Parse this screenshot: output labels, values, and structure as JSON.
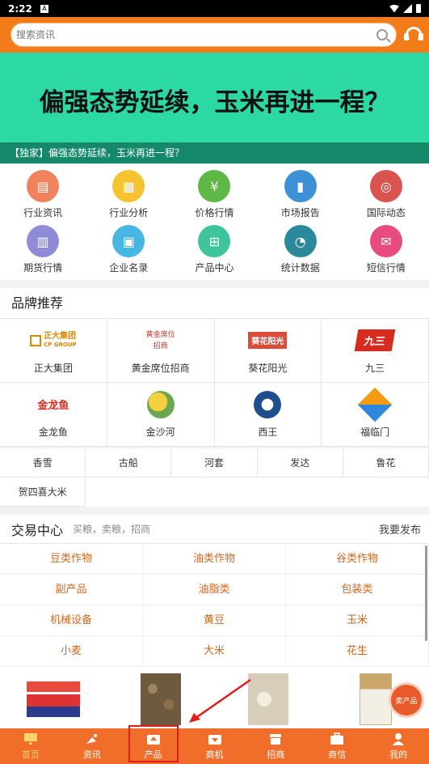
{
  "statusbar": {
    "time": "2:22",
    "app_icon": "A"
  },
  "search": {
    "placeholder": "搜索资讯"
  },
  "banner": {
    "headline": "偏强态势延续，玉米再进一程？",
    "caption": "【独家】偏强态势延续，玉米再进一程？"
  },
  "categories": [
    {
      "label": "行业资讯",
      "color": "#f0825d"
    },
    {
      "label": "行业分析",
      "color": "#f5c330"
    },
    {
      "label": "价格行情",
      "color": "#5db845"
    },
    {
      "label": "市场报告",
      "color": "#3d8fd6"
    },
    {
      "label": "国际动态",
      "color": "#d9534f"
    },
    {
      "label": "期货行情",
      "color": "#8f8bd6"
    },
    {
      "label": "企业名录",
      "color": "#47b6e0"
    },
    {
      "label": "产品中心",
      "color": "#3ec49c"
    },
    {
      "label": "统计数据",
      "color": "#2a8a9a"
    },
    {
      "label": "短信行情",
      "color": "#e64d7c"
    }
  ],
  "brands": {
    "title": "品牌推荐",
    "items": [
      {
        "label": "正大集团",
        "logo_text": "正大集团",
        "logo_sub": "CP GROUP"
      },
      {
        "label": "黄金席位招商",
        "logo_text": "黄金席位",
        "logo_sub": "招商"
      },
      {
        "label": "葵花阳光",
        "logo_text": "葵花阳光",
        "logo_sub": ""
      },
      {
        "label": "九三",
        "logo_text": "九三",
        "logo_sub": ""
      },
      {
        "label": "金龙鱼",
        "logo_text": "金龙鱼",
        "logo_sub": ""
      },
      {
        "label": "金沙河",
        "logo_text": "",
        "logo_sub": ""
      },
      {
        "label": "西王",
        "logo_text": "",
        "logo_sub": ""
      },
      {
        "label": "福临门",
        "logo_text": "",
        "logo_sub": ""
      }
    ]
  },
  "tags": [
    "香雪",
    "古船",
    "河套",
    "发达",
    "鲁花",
    "贺四喜大米"
  ],
  "trade": {
    "title": "交易中心",
    "subtitle": "买粮，卖粮，招商",
    "publish": "我要发布",
    "items": [
      "豆类作物",
      "油类作物",
      "谷类作物",
      "副产品",
      "油脂类",
      "包装类",
      "机械设备",
      "黄豆",
      "玉米",
      "小麦",
      "大米",
      "花生"
    ]
  },
  "sell_button": "卖产品",
  "tabs": [
    {
      "label": "首页",
      "icon": "monitor-icon"
    },
    {
      "label": "资讯",
      "icon": "satellite-icon"
    },
    {
      "label": "产品",
      "icon": "upload-box-icon"
    },
    {
      "label": "商机",
      "icon": "download-box-icon"
    },
    {
      "label": "招商",
      "icon": "store-icon"
    },
    {
      "label": "商信",
      "icon": "briefcase-icon"
    },
    {
      "label": "我的",
      "icon": "user-icon"
    }
  ],
  "colors": {
    "brand_orange": "#f27c1a",
    "banner_green": "#2cd8a3",
    "tab_active": "#ffd36a",
    "trade_text": "#d2661e",
    "highlight_red": "#e41c1c"
  }
}
